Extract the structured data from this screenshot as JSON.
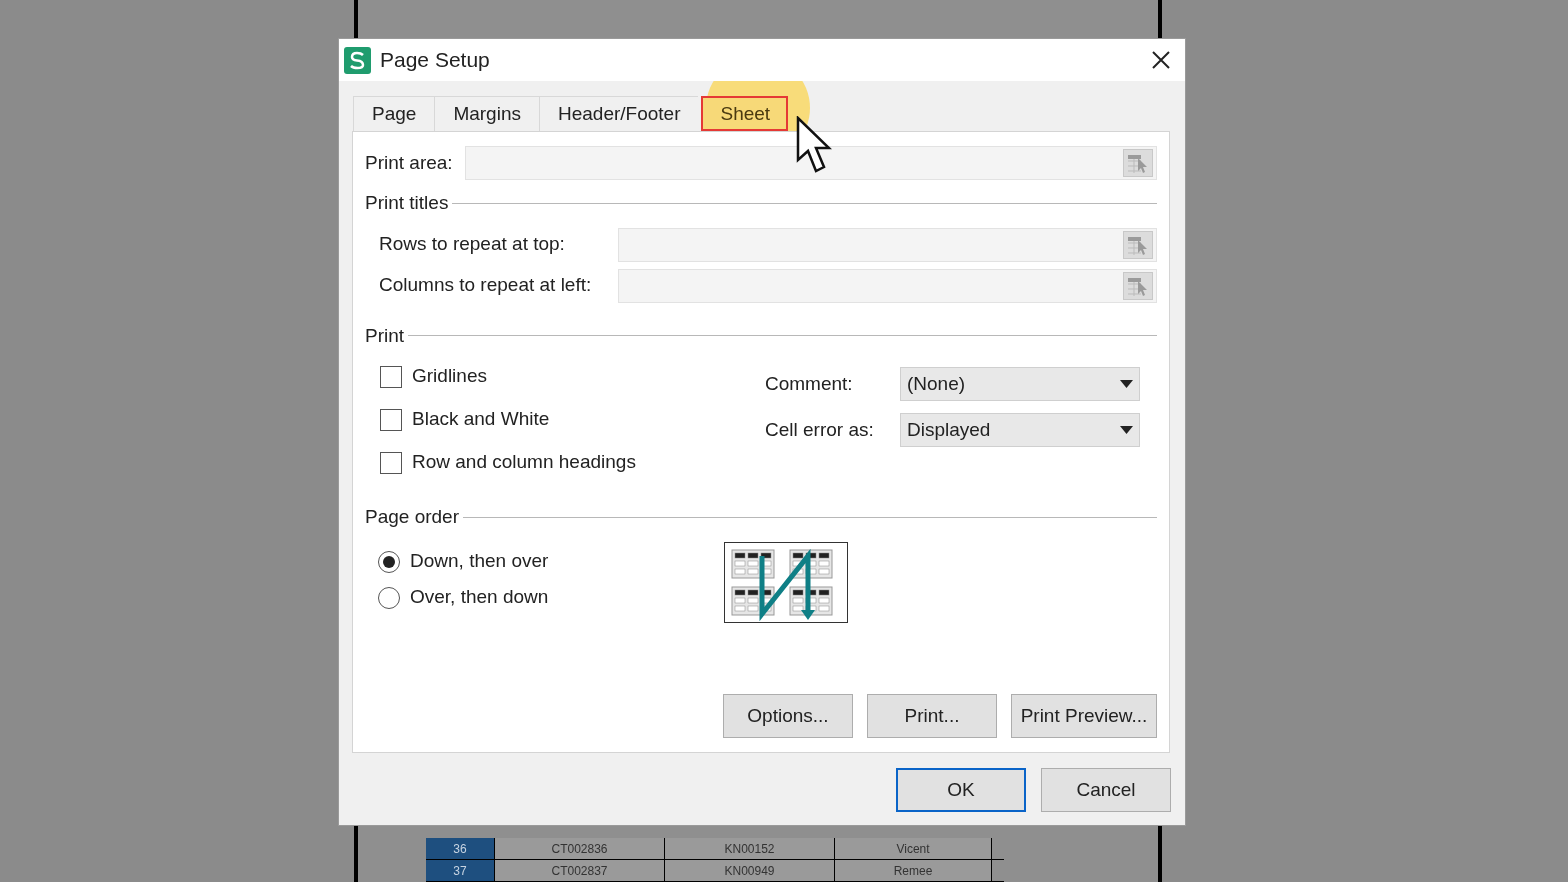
{
  "spreadsheet": {
    "rows": [
      {
        "row": "36",
        "cells": [
          "CT002836",
          "KN00152",
          "Vicent"
        ]
      },
      {
        "row": "37",
        "cells": [
          "CT002837",
          "KN00949",
          "Remee"
        ]
      }
    ]
  },
  "dialog": {
    "title": "Page Setup",
    "tabs": [
      {
        "label": "Page",
        "selected": false
      },
      {
        "label": "Margins",
        "selected": false
      },
      {
        "label": "Header/Footer",
        "selected": false
      },
      {
        "label": "Sheet",
        "selected": true
      }
    ],
    "print_area": {
      "label": "Print area:"
    },
    "print_titles": {
      "heading": "Print titles",
      "fields": [
        {
          "label": "Rows to repeat at top:"
        },
        {
          "label": "Columns to repeat at left:"
        }
      ]
    },
    "print": {
      "heading": "Print",
      "checkboxes": [
        {
          "label": "Gridlines",
          "checked": false
        },
        {
          "label": "Black and White",
          "checked": false
        },
        {
          "label": "Row and column headings",
          "checked": false
        }
      ],
      "dropdowns": [
        {
          "label": "Comment:",
          "value": "(None)"
        },
        {
          "label": "Cell error as:",
          "value": "Displayed"
        }
      ]
    },
    "page_order": {
      "heading": "Page order",
      "options": [
        {
          "label": "Down, then over",
          "selected": true
        },
        {
          "label": "Over, then down",
          "selected": false
        }
      ]
    },
    "buttons": [
      "Options...",
      "Print...",
      "Print Preview..."
    ],
    "footer_buttons": [
      {
        "label": "OK",
        "default": true
      },
      {
        "label": "Cancel",
        "default": false
      }
    ]
  }
}
